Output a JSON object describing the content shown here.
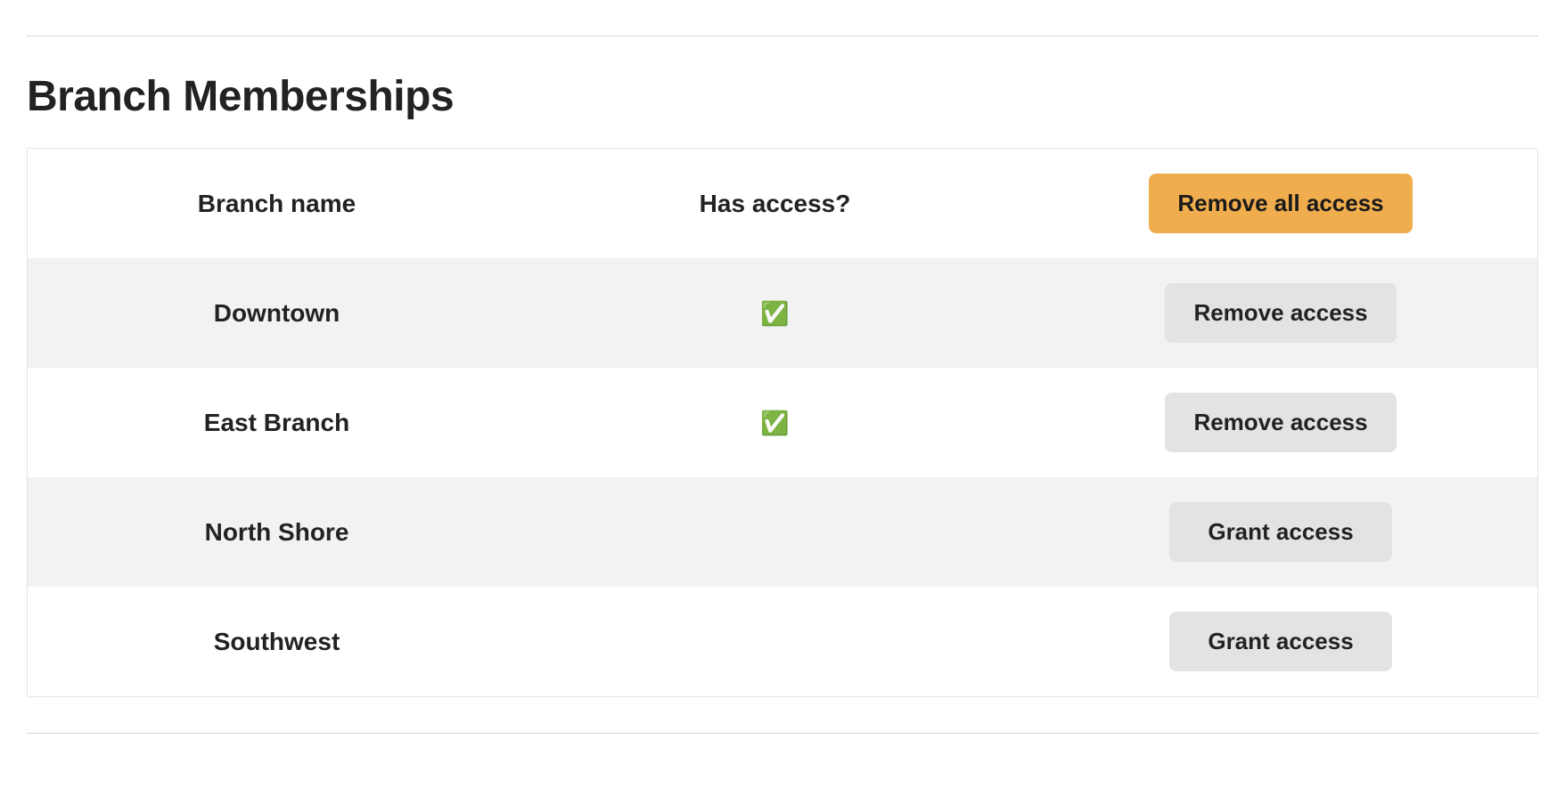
{
  "title": "Branch Memberships",
  "headers": {
    "branch_name": "Branch name",
    "has_access": "Has access?",
    "remove_all": "Remove all access"
  },
  "icons": {
    "check": "✅"
  },
  "rows": [
    {
      "name": "Downtown",
      "has_access": true,
      "action_label": "Remove access"
    },
    {
      "name": "East Branch",
      "has_access": true,
      "action_label": "Remove access"
    },
    {
      "name": "North Shore",
      "has_access": false,
      "action_label": "Grant access"
    },
    {
      "name": "Southwest",
      "has_access": false,
      "action_label": "Grant access"
    }
  ]
}
